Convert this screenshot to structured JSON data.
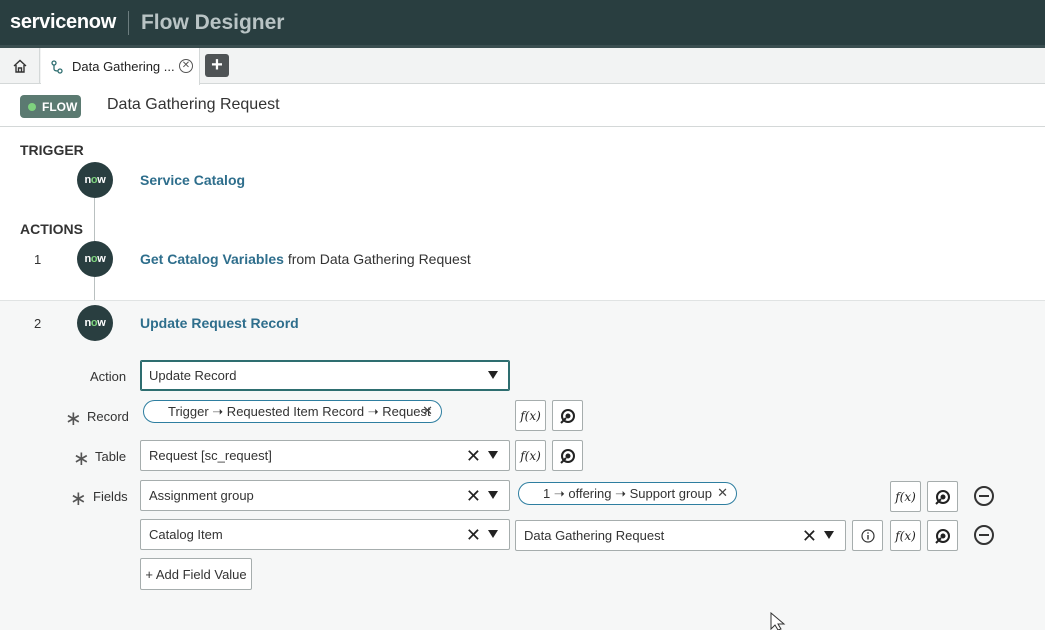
{
  "topbar": {
    "brand": "servicenow",
    "app_title": "Flow Designer"
  },
  "tabs": {
    "active_label": "Data Gathering ...",
    "close_symbol": "⊗",
    "add_symbol": "+"
  },
  "header": {
    "badge": "FLOW",
    "flow_name": "Data Gathering Request"
  },
  "trigger": {
    "section": "TRIGGER",
    "logo": "now",
    "name": "Service Catalog"
  },
  "actions": {
    "section": "ACTIONS",
    "items": [
      {
        "num": "1",
        "logo": "now",
        "name": "Get Catalog Variables",
        "suffix": " from Data Gathering Request"
      },
      {
        "num": "2",
        "logo": "now",
        "name": "Update Request Record"
      }
    ]
  },
  "form": {
    "action_label": "Action",
    "action_value": "Update Record",
    "record_label": "Record",
    "record_pill": "Trigger ➝ Requested Item Record ➝ Request",
    "table_label": "Table",
    "table_value": "Request [sc_request]",
    "fields_label": "Fields",
    "fields": [
      {
        "field": "Assignment group",
        "value_pill": "1 ➝ offering ➝ Support group"
      },
      {
        "field": "Catalog Item",
        "value": "Data Gathering Request"
      }
    ],
    "fx_label": "f(x)",
    "add_field_label": "+ Add Field Value"
  }
}
